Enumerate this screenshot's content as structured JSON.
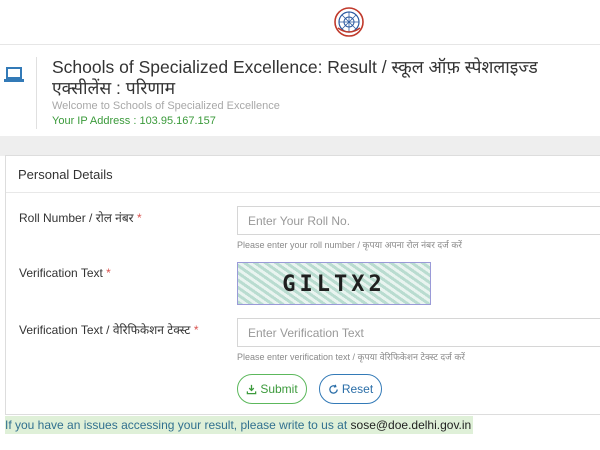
{
  "header": {
    "emblem": "emblem-icon",
    "title": "Schools of Specialized Excellence: Result / स्कूल ऑफ़ स्पेशलाइज्ड एक्सीलेंस : परिणाम",
    "welcome": "Welcome to Schools of Specialized Excellence",
    "ip_text": "Your IP Address : 103.95.167.157"
  },
  "form": {
    "section_title": "Personal Details",
    "roll": {
      "label": "Roll Number / रोल नंबर",
      "required": "*",
      "placeholder": "Enter Your Roll No.",
      "hint": "Please enter your roll number / कृपया अपना रोल नंबर दर्ज करें"
    },
    "captcha": {
      "label": "Verification Text",
      "required": "*",
      "image_text": "GILTX2"
    },
    "verification": {
      "label": "Verification Text / वेरिफिकेशन टेक्स्ट",
      "required": "*",
      "placeholder": "Enter Verification Text",
      "hint": "Please enter verification text / कृपया वेरिफिकेशन टेक्स्ट दर्ज करें"
    },
    "buttons": {
      "submit": "Submit",
      "reset": "Reset"
    }
  },
  "notice": {
    "text": "If you have an issues accessing your result, please write to us at",
    "email": "sose@doe.delhi.gov.in"
  },
  "colors": {
    "success": "#5cb85c",
    "primary": "#337ab7",
    "required": "#d9534f",
    "notice_bg": "#dff0d8"
  }
}
